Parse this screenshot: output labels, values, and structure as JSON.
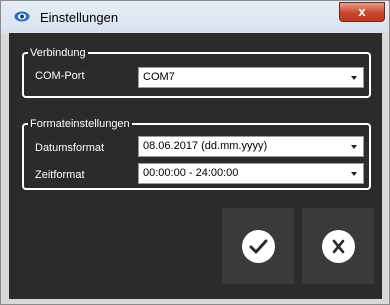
{
  "window": {
    "title": "Einstellungen",
    "close_label": "x"
  },
  "verbindung": {
    "legend": "Verbindung",
    "com_port_label": "COM-Port",
    "com_port_value": "COM7"
  },
  "format": {
    "legend": "Formateinstellungen",
    "datum_label": "Datumsformat",
    "datum_value": "08.06.2017 (dd.mm.yyyy)",
    "zeit_label": "Zeitformat",
    "zeit_value": "00:00:00 - 24:00:00"
  },
  "buttons": {
    "ok_icon": "check-icon",
    "cancel_icon": "x-icon"
  },
  "colors": {
    "panel": "#2b2b2b",
    "tile": "#3a3a3a",
    "close": "#c9462c"
  }
}
